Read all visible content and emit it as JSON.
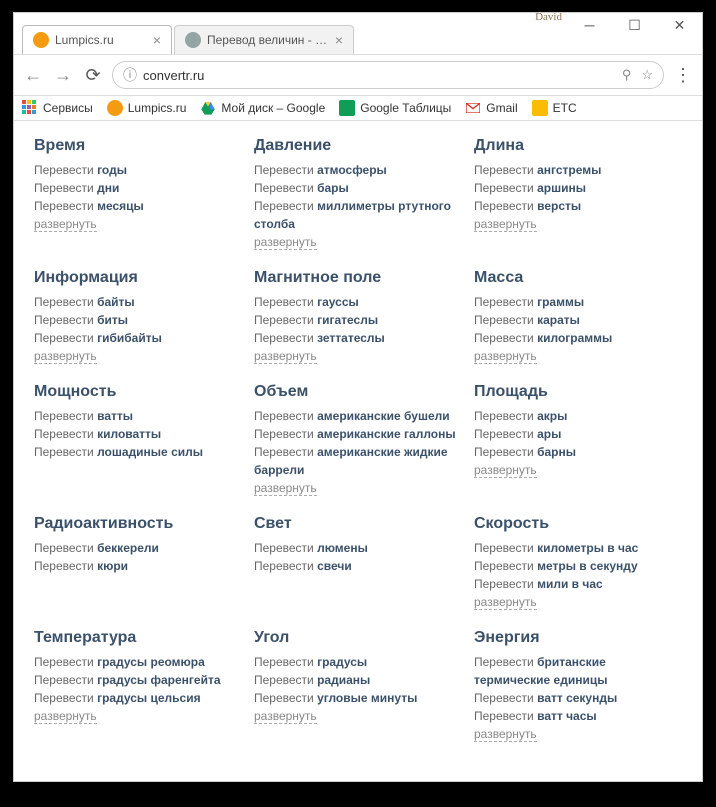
{
  "window": {
    "user_label": "David"
  },
  "tabs": [
    {
      "title": "Lumpics.ru",
      "icon_color": "#f39c12",
      "active": true
    },
    {
      "title": "Перевод величин - конв",
      "icon_color": "#95a5a6",
      "active": false
    }
  ],
  "nav": {
    "url": "convertr.ru"
  },
  "bookmarks": [
    {
      "label": "Сервисы",
      "icon": "apps"
    },
    {
      "label": "Lumpics.ru",
      "icon": "orange"
    },
    {
      "label": "Мой диск – Google",
      "icon": "drive"
    },
    {
      "label": "Google Таблицы",
      "icon": "sheets"
    },
    {
      "label": "Gmail",
      "icon": "gmail"
    },
    {
      "label": "ETC",
      "icon": "folder"
    }
  ],
  "convert_prefix": "Перевести",
  "expand_label": "развернуть",
  "categories": [
    {
      "title": "Время",
      "items": [
        "годы",
        "дни",
        "месяцы"
      ],
      "expand": true
    },
    {
      "title": "Давление",
      "items": [
        "атмосферы",
        "бары",
        "миллиметры ртутного столба"
      ],
      "expand": true
    },
    {
      "title": "Длина",
      "items": [
        "ангстремы",
        "аршины",
        "версты"
      ],
      "expand": true
    },
    {
      "title": "Информация",
      "items": [
        "байты",
        "биты",
        "гибибайты"
      ],
      "expand": true
    },
    {
      "title": "Магнитное поле",
      "items": [
        "гауссы",
        "гигатеслы",
        "зеттатеслы"
      ],
      "expand": true
    },
    {
      "title": "Масса",
      "items": [
        "граммы",
        "караты",
        "килограммы"
      ],
      "expand": true
    },
    {
      "title": "Мощность",
      "items": [
        "ватты",
        "киловатты",
        "лошадиные силы"
      ],
      "expand": false
    },
    {
      "title": "Объем",
      "items": [
        "американские бушели",
        "американские галлоны",
        "американские жидкие баррели"
      ],
      "expand": true
    },
    {
      "title": "Площадь",
      "items": [
        "акры",
        "ары",
        "барны"
      ],
      "expand": true
    },
    {
      "title": "Радиоактивность",
      "items": [
        "беккерели",
        "кюри"
      ],
      "expand": false
    },
    {
      "title": "Свет",
      "items": [
        "люмены",
        "свечи"
      ],
      "expand": false
    },
    {
      "title": "Скорость",
      "items": [
        "километры в час",
        "метры в секунду",
        "мили в час"
      ],
      "expand": true
    },
    {
      "title": "Температура",
      "items": [
        "градусы реомюра",
        "градусы фаренгейта",
        "градусы цельсия"
      ],
      "expand": true
    },
    {
      "title": "Угол",
      "items": [
        "градусы",
        "радианы",
        "угловые минуты"
      ],
      "expand": true
    },
    {
      "title": "Энергия",
      "items": [
        "британские термические единицы",
        "ватт секунды",
        "ватт часы"
      ],
      "expand": true
    }
  ]
}
